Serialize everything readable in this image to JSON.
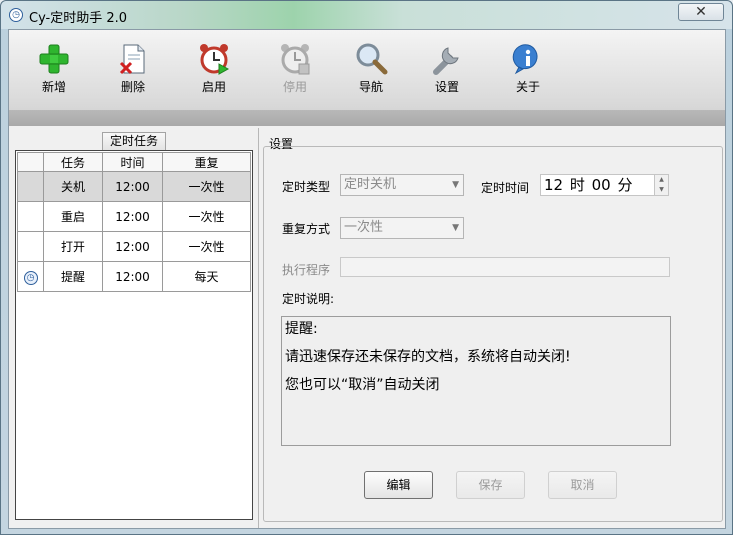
{
  "window": {
    "title": "Cy-定时助手 2.0",
    "close_symbol": "✕"
  },
  "toolbar": {
    "items": [
      {
        "label": "新增",
        "icon": "plus-icon",
        "enabled": true
      },
      {
        "label": "删除",
        "icon": "delete-document-icon",
        "enabled": true
      },
      {
        "label": "启用",
        "icon": "alarm-clock-play-icon",
        "enabled": true
      },
      {
        "label": "停用",
        "icon": "alarm-clock-stop-icon",
        "enabled": false
      },
      {
        "label": "导航",
        "icon": "magnifier-icon",
        "enabled": true
      },
      {
        "label": "设置",
        "icon": "wrench-icon",
        "enabled": true
      },
      {
        "label": "关于",
        "icon": "info-icon",
        "enabled": true
      }
    ]
  },
  "tasks": {
    "group_title": "定时任务",
    "columns": [
      "任务",
      "时间",
      "重复"
    ],
    "rows": [
      {
        "task": "关机",
        "time": "12:00",
        "repeat": "一次性",
        "selected": true,
        "mark": false
      },
      {
        "task": "重启",
        "time": "12:00",
        "repeat": "一次性",
        "selected": false,
        "mark": false
      },
      {
        "task": "打开",
        "time": "12:00",
        "repeat": "一次性",
        "selected": false,
        "mark": false
      },
      {
        "task": "提醒",
        "time": "12:00",
        "repeat": "每天",
        "selected": false,
        "mark": true
      }
    ]
  },
  "settings": {
    "title": "设置",
    "type_label": "定时类型",
    "type_value": "定时关机",
    "time_label": "定时时间",
    "time_value": "12 时 00 分",
    "repeat_label": "重复方式",
    "repeat_value": "一次性",
    "program_label": "执行程序",
    "program_value": "",
    "desc_label": "定时说明:",
    "desc_lines": [
      "提醒:",
      "请迅速保存还未保存的文档，系统将自动关闭!",
      "您也可以“取消”自动关闭"
    ],
    "buttons": {
      "edit": "编辑",
      "save": "保存",
      "cancel": "取消"
    }
  },
  "colors": {
    "accent": "#2e5f9b",
    "plus_green": "#2fb52f",
    "delete_red": "#d02020"
  }
}
